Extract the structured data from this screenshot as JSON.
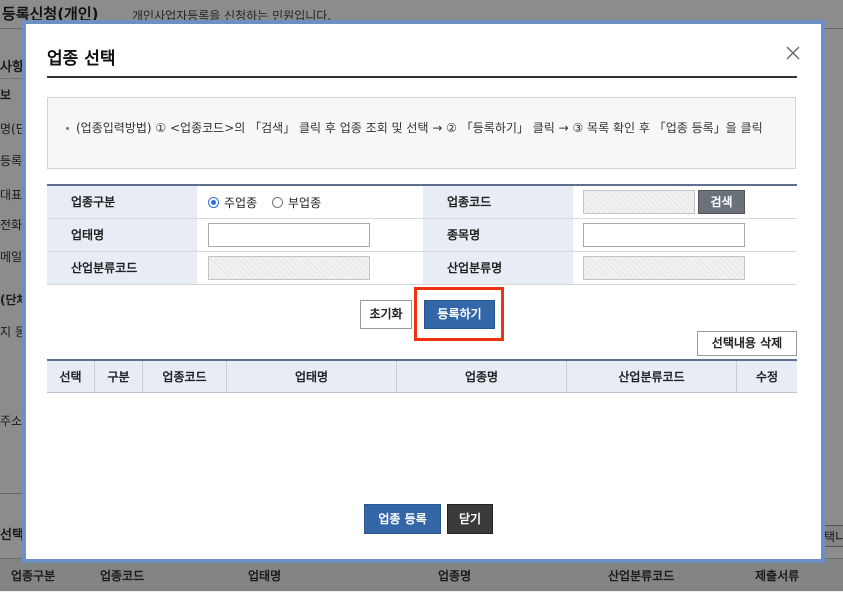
{
  "background": {
    "title": "등록신청(개인)",
    "description": "개인사업자등록을 신청하는 민원입니다.",
    "left_labels": [
      "사항",
      "보",
      "명(단",
      "등록",
      "대표",
      "전화",
      "메일",
      "(단체",
      "지 동",
      "주소",
      "선택"
    ],
    "strip_button": "택니",
    "table_headers": [
      "업종구분",
      "업종코드",
      "업태명",
      "업종명",
      "산업분류코드",
      "제출서류"
    ]
  },
  "modal": {
    "title": "업종 선택",
    "close_icon": "close-icon",
    "guide": "(업종입력방법) ① <업종코드>의 「검색」 클릭 후 업종 조회 및 선택 → ② 「등록하기」 클릭 → ③ 목록 확인 후 「업종 등록」을 클릭",
    "form": {
      "business_type_label": "업종구분",
      "radio_main": "주업종",
      "radio_sub": "부업종",
      "radio_selected": "주업종",
      "industry_code_label": "업종코드",
      "industry_code_value": "",
      "search_button": "검색",
      "business_name_label": "업태명",
      "business_name_value": "",
      "item_name_label": "종목명",
      "item_name_value": "",
      "std_code_label": "산업분류코드",
      "std_code_value": "",
      "std_name_label": "산업분류명",
      "std_name_value": ""
    },
    "buttons": {
      "reset": "초기화",
      "register": "등록하기",
      "delete_selected": "선택내용 삭제",
      "submit": "업종 등록",
      "close": "닫기"
    },
    "list_headers": [
      "선택",
      "구분",
      "업종코드",
      "업태명",
      "업종명",
      "산업분류코드",
      "수정"
    ],
    "highlight_color": "#f0300e",
    "border_color": "#6e8fc4"
  }
}
